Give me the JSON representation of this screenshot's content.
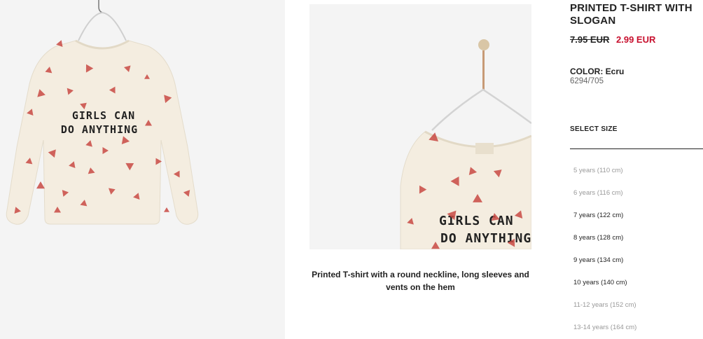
{
  "product": {
    "title": "PRINTED T-SHIRT WITH SLOGAN",
    "price_old": "7.95 EUR",
    "price_new": "2.99 EUR",
    "color_label": "COLOR: Ecru",
    "reference": "6294/705",
    "description": "Printed T-shirt with a round neckline, long sleeves and vents on the hem",
    "slogan_line1": "GIRLS CAN",
    "slogan_line2": "DO ANYTHING",
    "slogan_mid_line1": "GIRLS CAN",
    "slogan_mid_line2": "DO ANYTHING"
  },
  "size_selector": {
    "label": "SELECT SIZE",
    "sizes": [
      {
        "label": "5 years (110 cm)",
        "available": false
      },
      {
        "label": "6 years (116 cm)",
        "available": false
      },
      {
        "label": "7 years (122 cm)",
        "available": true
      },
      {
        "label": "8 years (128 cm)",
        "available": true
      },
      {
        "label": "9 years (134 cm)",
        "available": true
      },
      {
        "label": "10 years (140 cm)",
        "available": true
      },
      {
        "label": "11-12 years (152 cm)",
        "available": false
      },
      {
        "label": "13-14 years (164 cm)",
        "available": false
      }
    ]
  },
  "colors": {
    "sale_red": "#c8102e",
    "shirt_ecru": "#f4ede0",
    "print_red": "#c94a44",
    "image_bg": "#f4f4f4"
  }
}
